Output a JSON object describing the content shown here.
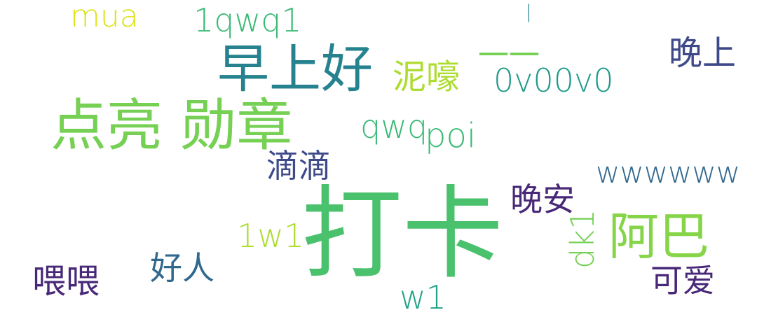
{
  "words": [
    {
      "text": "mua",
      "color": "#dde318"
    },
    {
      "text": "1qwq1",
      "color": "#3aba76"
    },
    {
      "text": "|",
      "color": "#25828e"
    },
    {
      "text": "早上好",
      "color": "#25828e"
    },
    {
      "text": "一一",
      "color": "#75d054"
    },
    {
      "text": "泥嚎",
      "color": "#addc30"
    },
    {
      "text": "0v00v0",
      "color": "#1f9a8a"
    },
    {
      "text": "晚上",
      "color": "#3e4989"
    },
    {
      "text": "点亮 勋章",
      "color": "#75d054"
    },
    {
      "text": "qwq",
      "color": "#3aba76"
    },
    {
      "text": "poi",
      "color": "#3aba76"
    },
    {
      "text": "滴滴",
      "color": "#3e4989"
    },
    {
      "text": "wwwwww",
      "color": "#31688e"
    },
    {
      "text": "晚安",
      "color": "#482878"
    },
    {
      "text": "打卡",
      "color": "#4ac16d"
    },
    {
      "text": "1w1",
      "color": "#addc30"
    },
    {
      "text": "dk1",
      "color": "#75d054"
    },
    {
      "text": "阿巴",
      "color": "#86d549"
    },
    {
      "text": "好人",
      "color": "#31688e"
    },
    {
      "text": "喂喂",
      "color": "#482878"
    },
    {
      "text": "w1",
      "color": "#20a386"
    },
    {
      "text": "可爱",
      "color": "#482878"
    }
  ]
}
